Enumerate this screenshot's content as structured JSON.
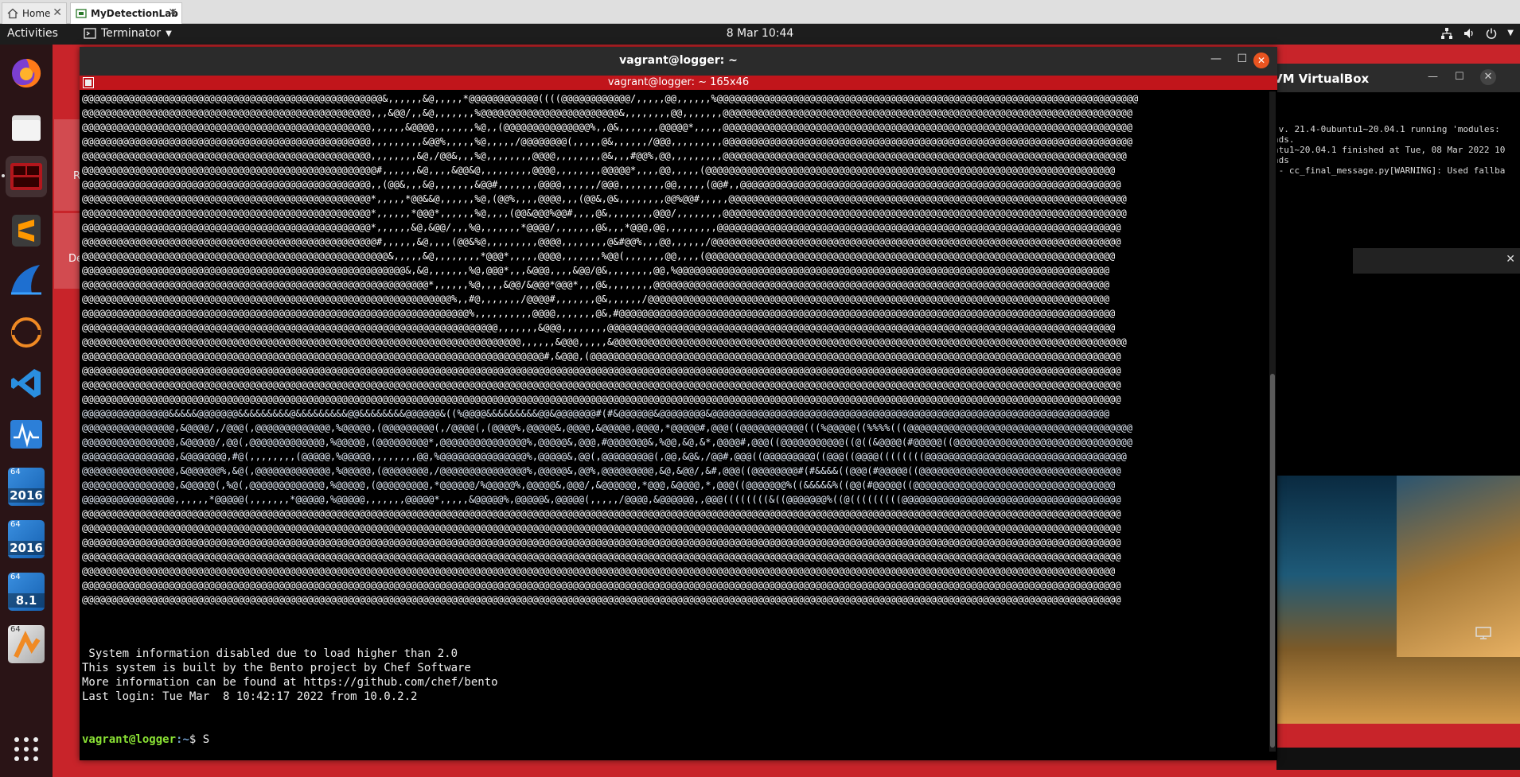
{
  "outer_tabs": [
    {
      "label": "Home",
      "icon": "home-icon"
    },
    {
      "label": "MyDetectionLab",
      "icon": "vm-icon"
    }
  ],
  "topbar": {
    "activities": "Activities",
    "app": "Terminator",
    "clock": "8 Mar  10:44",
    "system_icons": [
      "network-icon",
      "volume-icon",
      "power-icon",
      "chevron-down-icon"
    ]
  },
  "dock": [
    {
      "name": "firefox"
    },
    {
      "name": "files"
    },
    {
      "name": "terminator"
    },
    {
      "name": "sublime-text"
    },
    {
      "name": "wireshark"
    },
    {
      "name": "eclipse"
    },
    {
      "name": "vscode"
    },
    {
      "name": "system-monitor"
    },
    {
      "name": "windows-vm",
      "badge": "64",
      "label": "2016"
    },
    {
      "name": "windows-vm",
      "badge": "64",
      "label": "2016"
    },
    {
      "name": "windows-vm",
      "badge": "64",
      "label": "8.1"
    },
    {
      "name": "vm-app",
      "badge": "64"
    },
    {
      "name": "show-apps"
    }
  ],
  "desktop_fragments": {
    "a": "R",
    "b": "De"
  },
  "vbox": {
    "title": "VM VirtualBox",
    "lines": [
      " v. 21.4-0ubuntu1~20.04.1 running 'modules:",
      "nds.",
      "ntu1~20.04.1 finished at Tue, 08 Mar 2022 10",
      "nds",
      " - cc_final_message.py[WARNING]: Used fallba"
    ]
  },
  "terminal": {
    "window_title": "vagrant@logger: ~",
    "tab_title": "vagrant@logger: ~ 165x46",
    "ascii_lines": [
      "@@@@@@@@@@@@@@@@@@@@@@@@@@@@@@@@@@@@@@@@@@@@@@@@@@@@&,,,,,,&@,,,,,*@@@@@@@@@@@@((((@@@@@@@@@@@@/,,,,,@@,,,,,,%@@@@@@@@@@@@@@@@@@@@@@@@@@@@@@@@@@@@@@@@@@@@@@@@@@@@@@@@@@@@@@@@@@@@@@@@@",
      "@@@@@@@@@@@@@@@@@@@@@@@@@@@@@@@@@@@@@@@@@@@@@@@@@@,,,&@@/,,&@,,,,,,,%@@@@@@@@@@@@@@@@@@@@@@@@&,,,,,,,,@@,,,,,,,@@@@@@@@@@@@@@@@@@@@@@@@@@@@@@@@@@@@@@@@@@@@@@@@@@@@@@@@@@@@@@@@@@@@@@@",
      "@@@@@@@@@@@@@@@@@@@@@@@@@@@@@@@@@@@@@@@@@@@@@@@@@@,,,,,,&@@@@,,,,,,,%@,,(@@@@@@@@@@@@@@@%,,@&,,,,,,,@@@@@*,,,,,@@@@@@@@@@@@@@@@@@@@@@@@@@@@@@@@@@@@@@@@@@@@@@@@@@@@@@@@@@@@@@@@@@@@@@@",
      "@@@@@@@@@@@@@@@@@@@@@@@@@@@@@@@@@@@@@@@@@@@@@@@@@@,,,,,,,,,&@@%,,,,,%@,,,,,/@@@@@@@@(,,,,,@&,,,,,,/@@@,,,,,,,,,@@@@@@@@@@@@@@@@@@@@@@@@@@@@@@@@@@@@@@@@@@@@@@@@@@@@@@@@@@@@@@@@@@@@@@@",
      "@@@@@@@@@@@@@@@@@@@@@@@@@@@@@@@@@@@@@@@@@@@@@@@@@@,,,,,,,,&@,/@@&,,,%@,,,,,,,,@@@@,,,,,,,,@&,,,#@@%,@@,,,,,,,,,@@@@@@@@@@@@@@@@@@@@@@@@@@@@@@@@@@@@@@@@@@@@@@@@@@@@@@@@@@@@@@@@@@@@@@",
      "@@@@@@@@@@@@@@@@@@@@@@@@@@@@@@@@@@@@@@@@@@@@@@@@@@@#,,,,,,&@,,,,&@@&@,,,,,,,,,@@@@,,,,,,,,@@@@@*,,,,@@,,,,,(@@@@@@@@@@@@@@@@@@@@@@@@@@@@@@@@@@@@@@@@@@@@@@@@@@@@@@@@@@@@@@@@@@@@@@@",
      "@@@@@@@@@@@@@@@@@@@@@@@@@@@@@@@@@@@@@@@@@@@@@@@@@@,,(@@&,,,&@,,,,,,,&@@#,,,,,,,@@@@,,,,,,/@@@,,,,,,,,@@,,,,,(@@#,,@@@@@@@@@@@@@@@@@@@@@@@@@@@@@@@@@@@@@@@@@@@@@@@@@@@@@@@@@@@@@@@@@@",
      "@@@@@@@@@@@@@@@@@@@@@@@@@@@@@@@@@@@@@@@@@@@@@@@@@@*,,,,,*@@&&@,,,,,,%@,(@@%,,,,@@@@,,,(@@&,@&,,,,,,,,@@%@@#,,,,,@@@@@@@@@@@@@@@@@@@@@@@@@@@@@@@@@@@@@@@@@@@@@@@@@@@@@@@@@@@@@@@@@@@@@",
      "@@@@@@@@@@@@@@@@@@@@@@@@@@@@@@@@@@@@@@@@@@@@@@@@@@*,,,,,,*@@@*,,,,,,%@,,,,(@@&@@@%@@#,,,,@&,,,,,,,,@@@/,,,,,,,,@@@@@@@@@@@@@@@@@@@@@@@@@@@@@@@@@@@@@@@@@@@@@@@@@@@@@@@@@@@@@@@@@@@@@@",
      "@@@@@@@@@@@@@@@@@@@@@@@@@@@@@@@@@@@@@@@@@@@@@@@@@@*,,,,,,&@,&@@/,,,%@,,,,,,,*@@@@/,,,,,,,@&,,,*@@@,@@,,,,,,,,,@@@@@@@@@@@@@@@@@@@@@@@@@@@@@@@@@@@@@@@@@@@@@@@@@@@@@@@@@@@@@@@@@@@@@@",
      "@@@@@@@@@@@@@@@@@@@@@@@@@@@@@@@@@@@@@@@@@@@@@@@@@@@#,,,,,,&@,,,,(@@&%@,,,,,,,,,@@@@,,,,,,,,@&#@@%,,,@@,,,,,,/@@@@@@@@@@@@@@@@@@@@@@@@@@@@@@@@@@@@@@@@@@@@@@@@@@@@@@@@@@@@@@@@@@@@@@@",
      "@@@@@@@@@@@@@@@@@@@@@@@@@@@@@@@@@@@@@@@@@@@@@@@@@@@@@&,,,,,&@,,,,,,,,*@@@*,,,,,@@@@,,,,,,,%@@(,,,,,,,@@,,,,(@@@@@@@@@@@@@@@@@@@@@@@@@@@@@@@@@@@@@@@@@@@@@@@@@@@@@@@@@@@@@@@@@@@@@@@",
      "@@@@@@@@@@@@@@@@@@@@@@@@@@@@@@@@@@@@@@@@@@@@@@@@@@@@@@@@&,&@,,,,,,,%@,@@@*,,,&@@@,,,,&@@/@&,,,,,,,,@@,%@@@@@@@@@@@@@@@@@@@@@@@@@@@@@@@@@@@@@@@@@@@@@@@@@@@@@@@@@@@@@@@@@@@@@@@@@@@",
      "@@@@@@@@@@@@@@@@@@@@@@@@@@@@@@@@@@@@@@@@@@@@@@@@@@@@@@@@@@@@*,,,,,,%@,,,,&@@/&@@@*@@@*,,,@&,,,,,,,,@@@@@@@@@@@@@@@@@@@@@@@@@@@@@@@@@@@@@@@@@@@@@@@@@@@@@@@@@@@@@@@@@@@@@@@@@@@@@@@",
      "@@@@@@@@@@@@@@@@@@@@@@@@@@@@@@@@@@@@@@@@@@@@@@@@@@@@@@@@@@@@@@@@%,,#@,,,,,,,/@@@@#,,,,,,,@&,,,,,,/@@@@@@@@@@@@@@@@@@@@@@@@@@@@@@@@@@@@@@@@@@@@@@@@@@@@@@@@@@@@@@@@@@@@@@@@@@@@@@@@",
      "@@@@@@@@@@@@@@@@@@@@@@@@@@@@@@@@@@@@@@@@@@@@@@@@@@@@@@@@@@@@@@@@@@@%,,,,,,,,,,@@@@,,,,,,,@&,#@@@@@@@@@@@@@@@@@@@@@@@@@@@@@@@@@@@@@@@@@@@@@@@@@@@@@@@@@@@@@@@@@@@@@@@@@@@@@@@@@@@@@@",
      "@@@@@@@@@@@@@@@@@@@@@@@@@@@@@@@@@@@@@@@@@@@@@@@@@@@@@@@@@@@@@@@@@@@@@@@@,,,,,,,&@@@,,,,,,,,@@@@@@@@@@@@@@@@@@@@@@@@@@@@@@@@@@@@@@@@@@@@@@@@@@@@@@@@@@@@@@@@@@@@@@@@@@@@@@@@@@@@@@@@",
      "@@@@@@@@@@@@@@@@@@@@@@@@@@@@@@@@@@@@@@@@@@@@@@@@@@@@@@@@@@@@@@@@@@@@@@@@@@@@,,,,,,&@@@,,,,,&@@@@@@@@@@@@@@@@@@@@@@@@@@@@@@@@@@@@@@@@@@@@@@@@@@@@@@@@@@@@@@@@@@@@@@@@@@@@@@@@@@@@@@@@@",
      "@@@@@@@@@@@@@@@@@@@@@@@@@@@@@@@@@@@@@@@@@@@@@@@@@@@@@@@@@@@@@@@@@@@@@@@@@@@@@@@@#,&@@@,(@@@@@@@@@@@@@@@@@@@@@@@@@@@@@@@@@@@@@@@@@@@@@@@@@@@@@@@@@@@@@@@@@@@@@@@@@@@@@@@@@@@@@@@@@@@@",
      "@@@@@@@@@@@@@@@@@@@@@@@@@@@@@@@@@@@@@@@@@@@@@@@@@@@@@@@@@@@@@@@@@@@@@@@@@@@@@@@@@@@@@@@@@@@@@@@@@@@@@@@@@@@@@@@@@@@@@@@@@@@@@@@@@@@@@@@@@@@@@@@@@@@@@@@@@@@@@@@@@@@@@@@@@@@@@@@@@@@@",
      "@@@@@@@@@@@@@@@@@@@@@@@@@@@@@@@@@@@@@@@@@@@@@@@@@@@@@@@@@@@@@@@@@@@@@@@@@@@@@@@@@@@@@@@@@@@@@@@@@@@@@@@@@@@@@@@@@@@@@@@@@@@@@@@@@@@@@@@@@@@@@@@@@@@@@@@@@@@@@@@@@@@@@@@@@@@@@@@@@@@@",
      "@@@@@@@@@@@@@@@@@@@@@@@@@@@@@@@@@@@@@@@@@@@@@@@@@@@@@@@@@@@@@@@@@@@@@@@@@@@@@@@@@@@@@@@@@@@@@@@@@@@@@@@@@@@@@@@@@@@@@@@@@@@@@@@@@@@@@@@@@@@@@@@@@@@@@@@@@@@@@@@@@@@@@@@@@@@@@@@@@@@@",
      "@@@@@@@@@@@@@@@&&&&&@@@@@@@&&&&&&&&&@&&&&&&&&&@@&&&&&&&&@@@@@@&((%@@@@&&&&&&&&&@@&@@@@@@@#(#&@@@@@@&@@@@@@@@&@@@@@@@@@@@@@@@@@@@@@@@@@@@@@@@@@@@@@@@@@@@@@@@@@@@@@@@@@@@@@@@@@@@@@",
      "@@@@@@@@@@@@@@@@,&@@@@/,/@@@(,@@@@@@@@@@@@@,%@@@@@,(@@@@@@@@@(,/@@@@(,(@@@@%,@@@@@&,@@@@,&@@@@@,@@@@,*@@@@@#,@@@((@@@@@@@@@@@(((%@@@@@((%%%%(((@@@@@@@@@@@@@@@@@@@@@@@@@@@@@@@@@@@@@@@",
      "@@@@@@@@@@@@@@@@,&@@@@@/,@@(,@@@@@@@@@@@@@,%@@@@@,(@@@@@@@@@*,@@@@@@@@@@@@@@@%,@@@@@&,@@@,#@@@@@@@&,%@@,&@,&*,@@@@#,@@@((@@@@@@@@@@@((@((&@@@@(#@@@@@((@@@@@@@@@@@@@@@@@@@@@@@@@@@@@@@",
      "@@@@@@@@@@@@@@@@,&@@@@@@@,#@(,,,,,,,,(@@@@@,%@@@@@,,,,,,,,@@,%@@@@@@@@@@@@@@@%,@@@@@&,@@(,@@@@@@@@@(,@@,&@&,/@@#,@@@((@@@@@@@@@((@@@((@@@@((((((((@@@@@@@@@@@@@@@@@@@@@@@@@@@@@@@@@@@",
      "@@@@@@@@@@@@@@@@,&@@@@@@%,&@(,@@@@@@@@@@@@@,%@@@@@,(@@@@@@@@,/@@@@@@@@@@@@@@@%,@@@@@&,@@%,@@@@@@@@@,&@,&@@/,&#,@@@((@@@@@@@@#(#&&&&((@@@(#@@@@@((@@@@@@@@@@@@@@@@@@@@@@@@@@@@@@@@@@@",
      "@@@@@@@@@@@@@@@@,&@@@@@(,%@(,@@@@@@@@@@@@@,%@@@@@,(@@@@@@@@@,*@@@@@@/%@@@@@%,@@@@@&,@@@/,&@@@@@@,*@@@,&@@@@,*,@@@((@@@@@@@%((&&&&&%((@@(#@@@@@((@@@@@@@@@@@@@@@@@@@@@@@@@@@@@@@@@@@",
      "@@@@@@@@@@@@@@@@,,,,,,*@@@@@(,,,,,,,*@@@@@,%@@@@@,,,,,,,@@@@@*,,,,,&@@@@@%,@@@@@&,@@@@@(,,,,,/@@@@,&@@@@@@,,@@@((((((((&((@@@@@@@%((@(((((((((@@@@@@@@@@@@@@@@@@@@@@@@@@@@@@@@@@@@@@",
      "@@@@@@@@@@@@@@@@@@@@@@@@@@@@@@@@@@@@@@@@@@@@@@@@@@@@@@@@@@@@@@@@@@@@@@@@@@@@@@@@@@@@@@@@@@@@@@@@@@@@@@@@@@@@@@@@@@@@@@@@@@@@@@@@@@@@@@@@@@@@@@@@@@@@@@@@@@@@@@@@@@@@@@@@@@@@@@@@@@@@",
      "@@@@@@@@@@@@@@@@@@@@@@@@@@@@@@@@@@@@@@@@@@@@@@@@@@@@@@@@@@@@@@@@@@@@@@@@@@@@@@@@@@@@@@@@@@@@@@@@@@@@@@@@@@@@@@@@@@@@@@@@@@@@@@@@@@@@@@@@@@@@@@@@@@@@@@@@@@@@@@@@@@@@@@@@@@@@@@@@@@@@",
      "@@@@@@@@@@@@@@@@@@@@@@@@@@@@@@@@@@@@@@@@@@@@@@@@@@@@@@@@@@@@@@@@@@@@@@@@@@@@@@@@@@@@@@@@@@@@@@@@@@@@@@@@@@@@@@@@@@@@@@@@@@@@@@@@@@@@@@@@@@@@@@@@@@@@@@@@@@@@@@@@@@@@@@@@@@@@@@@@@@@@",
      "@@@@@@@@@@@@@@@@@@@@@@@@@@@@@@@@@@@@@@@@@@@@@@@@@@@@@@@@@@@@@@@@@@@@@@@@@@@@@@@@@@@@@@@@@@@@@@@@@@@@@@@@@@@@@@@@@@@@@@@@@@@@@@@@@@@@@@@@@@@@@@@@@@@@@@@@@@@@@@@@@@@@@@@@@@@@@@@@@@@@",
      "@@@@@@@@@@@@@@@@@@@@@@@@@@@@@@@@@@@@@@@@@@@@@@@@@@@@@@@@@@@@@@@@@@@@@@@@@@@@@@@@@@@@@@@@@@@@@@@@@@@@@@@@@@@@@@@@@@@@@@@@@@@@@@@@@@@@@@@@@@@@@@@@@@@@@@@@@@@@@@@@@@@@@@@@@@@@@@@@@@@",
      "@@@@@@@@@@@@@@@@@@@@@@@@@@@@@@@@@@@@@@@@@@@@@@@@@@@@@@@@@@@@@@@@@@@@@@@@@@@@@@@@@@@@@@@@@@@@@@@@@@@@@@@@@@@@@@@@@@@@@@@@@@@@@@@@@@@@@@@@@@@@@@@@@@@@@@@@@@@@@@@@@@@@@@@@@@@@@@@@@@@@",
      "@@@@@@@@@@@@@@@@@@@@@@@@@@@@@@@@@@@@@@@@@@@@@@@@@@@@@@@@@@@@@@@@@@@@@@@@@@@@@@@@@@@@@@@@@@@@@@@@@@@@@@@@@@@@@@@@@@@@@@@@@@@@@@@@@@@@@@@@@@@@@@@@@@@@@@@@@@@@@@@@@@@@@@@@@@@@@@@@@@@@"
    ],
    "messages": [
      " System information disabled due to load higher than 2.0",
      "",
      "",
      "This system is built by the Bento project by Chef Software",
      "More information can be found at https://github.com/chef/bento",
      "Last login: Tue Mar  8 10:42:17 2022 from 10.0.2.2"
    ],
    "prompt_user": "vagrant@logger",
    "prompt_path": ":~",
    "prompt_suffix": "$ S"
  }
}
